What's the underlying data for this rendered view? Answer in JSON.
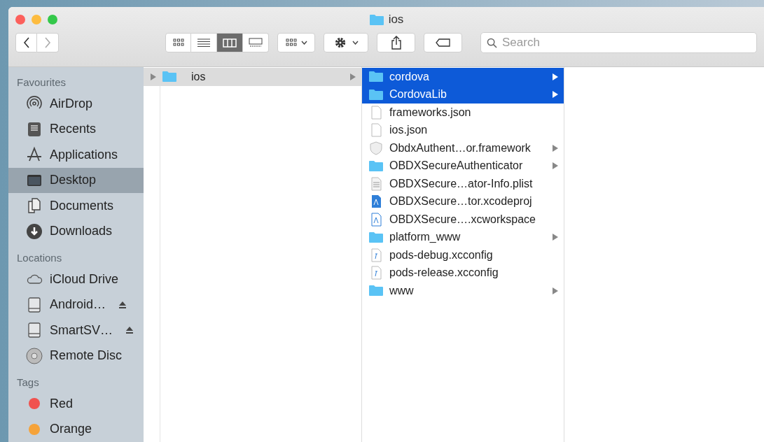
{
  "window": {
    "title": "ios"
  },
  "toolbar": {
    "view_buttons": [
      {
        "kind": "icons",
        "selected": false
      },
      {
        "kind": "list",
        "selected": false
      },
      {
        "kind": "columns",
        "selected": true
      },
      {
        "kind": "gallery",
        "selected": false
      }
    ],
    "search": {
      "placeholder": "Search"
    }
  },
  "sidebar": {
    "sections": [
      {
        "heading": "Favourites",
        "items": [
          {
            "label": "AirDrop",
            "kind": "airdrop",
            "selected": false
          },
          {
            "label": "Recents",
            "kind": "recents",
            "selected": false
          },
          {
            "label": "Applications",
            "kind": "applications",
            "selected": false
          },
          {
            "label": "Desktop",
            "kind": "desktop",
            "selected": true
          },
          {
            "label": "Documents",
            "kind": "documents",
            "selected": false
          },
          {
            "label": "Downloads",
            "kind": "downloads",
            "selected": false
          }
        ]
      },
      {
        "heading": "Locations",
        "items": [
          {
            "label": "iCloud Drive",
            "kind": "cloud",
            "selected": false
          },
          {
            "label": "Android…",
            "kind": "drive",
            "eject": true,
            "selected": false
          },
          {
            "label": "SmartSV…",
            "kind": "drive",
            "eject": true,
            "selected": false
          },
          {
            "label": "Remote Disc",
            "kind": "disc",
            "selected": false
          }
        ]
      },
      {
        "heading": "Tags",
        "items": [
          {
            "label": "Red",
            "kind": "tag",
            "color": "#f0524f",
            "selected": false
          },
          {
            "label": "Orange",
            "kind": "tag",
            "color": "#f5a33a",
            "selected": false
          }
        ]
      }
    ]
  },
  "columns": [
    {
      "items": [
        {
          "label": "ios",
          "kind": "folder",
          "has_children": true,
          "selected": true
        }
      ]
    },
    {
      "items": [
        {
          "label": "cordova",
          "kind": "folder",
          "has_children": true,
          "selected": true
        },
        {
          "label": "CordovaLib",
          "kind": "folder",
          "has_children": true,
          "selected": true
        },
        {
          "label": "frameworks.json",
          "kind": "document",
          "has_children": false,
          "selected": false
        },
        {
          "label": "ios.json",
          "kind": "document",
          "has_children": false,
          "selected": false
        },
        {
          "label": "ObdxAuthent…or.framework",
          "kind": "framework",
          "has_children": true,
          "selected": false
        },
        {
          "label": "OBDXSecureAuthenticator",
          "kind": "folder",
          "has_children": true,
          "selected": false
        },
        {
          "label": "OBDXSecure…ator-Info.plist",
          "kind": "plist",
          "has_children": false,
          "selected": false
        },
        {
          "label": "OBDXSecure…tor.xcodeproj",
          "kind": "xcodeproj",
          "has_children": false,
          "selected": false
        },
        {
          "label": "OBDXSecure….xcworkspace",
          "kind": "workspace",
          "has_children": false,
          "selected": false
        },
        {
          "label": "platform_www",
          "kind": "folder",
          "has_children": true,
          "selected": false
        },
        {
          "label": "pods-debug.xcconfig",
          "kind": "xcconfig",
          "has_children": false,
          "selected": false
        },
        {
          "label": "pods-release.xcconfig",
          "kind": "xcconfig",
          "has_children": false,
          "selected": false
        },
        {
          "label": "www",
          "kind": "folder",
          "has_children": true,
          "selected": false
        }
      ]
    }
  ]
}
